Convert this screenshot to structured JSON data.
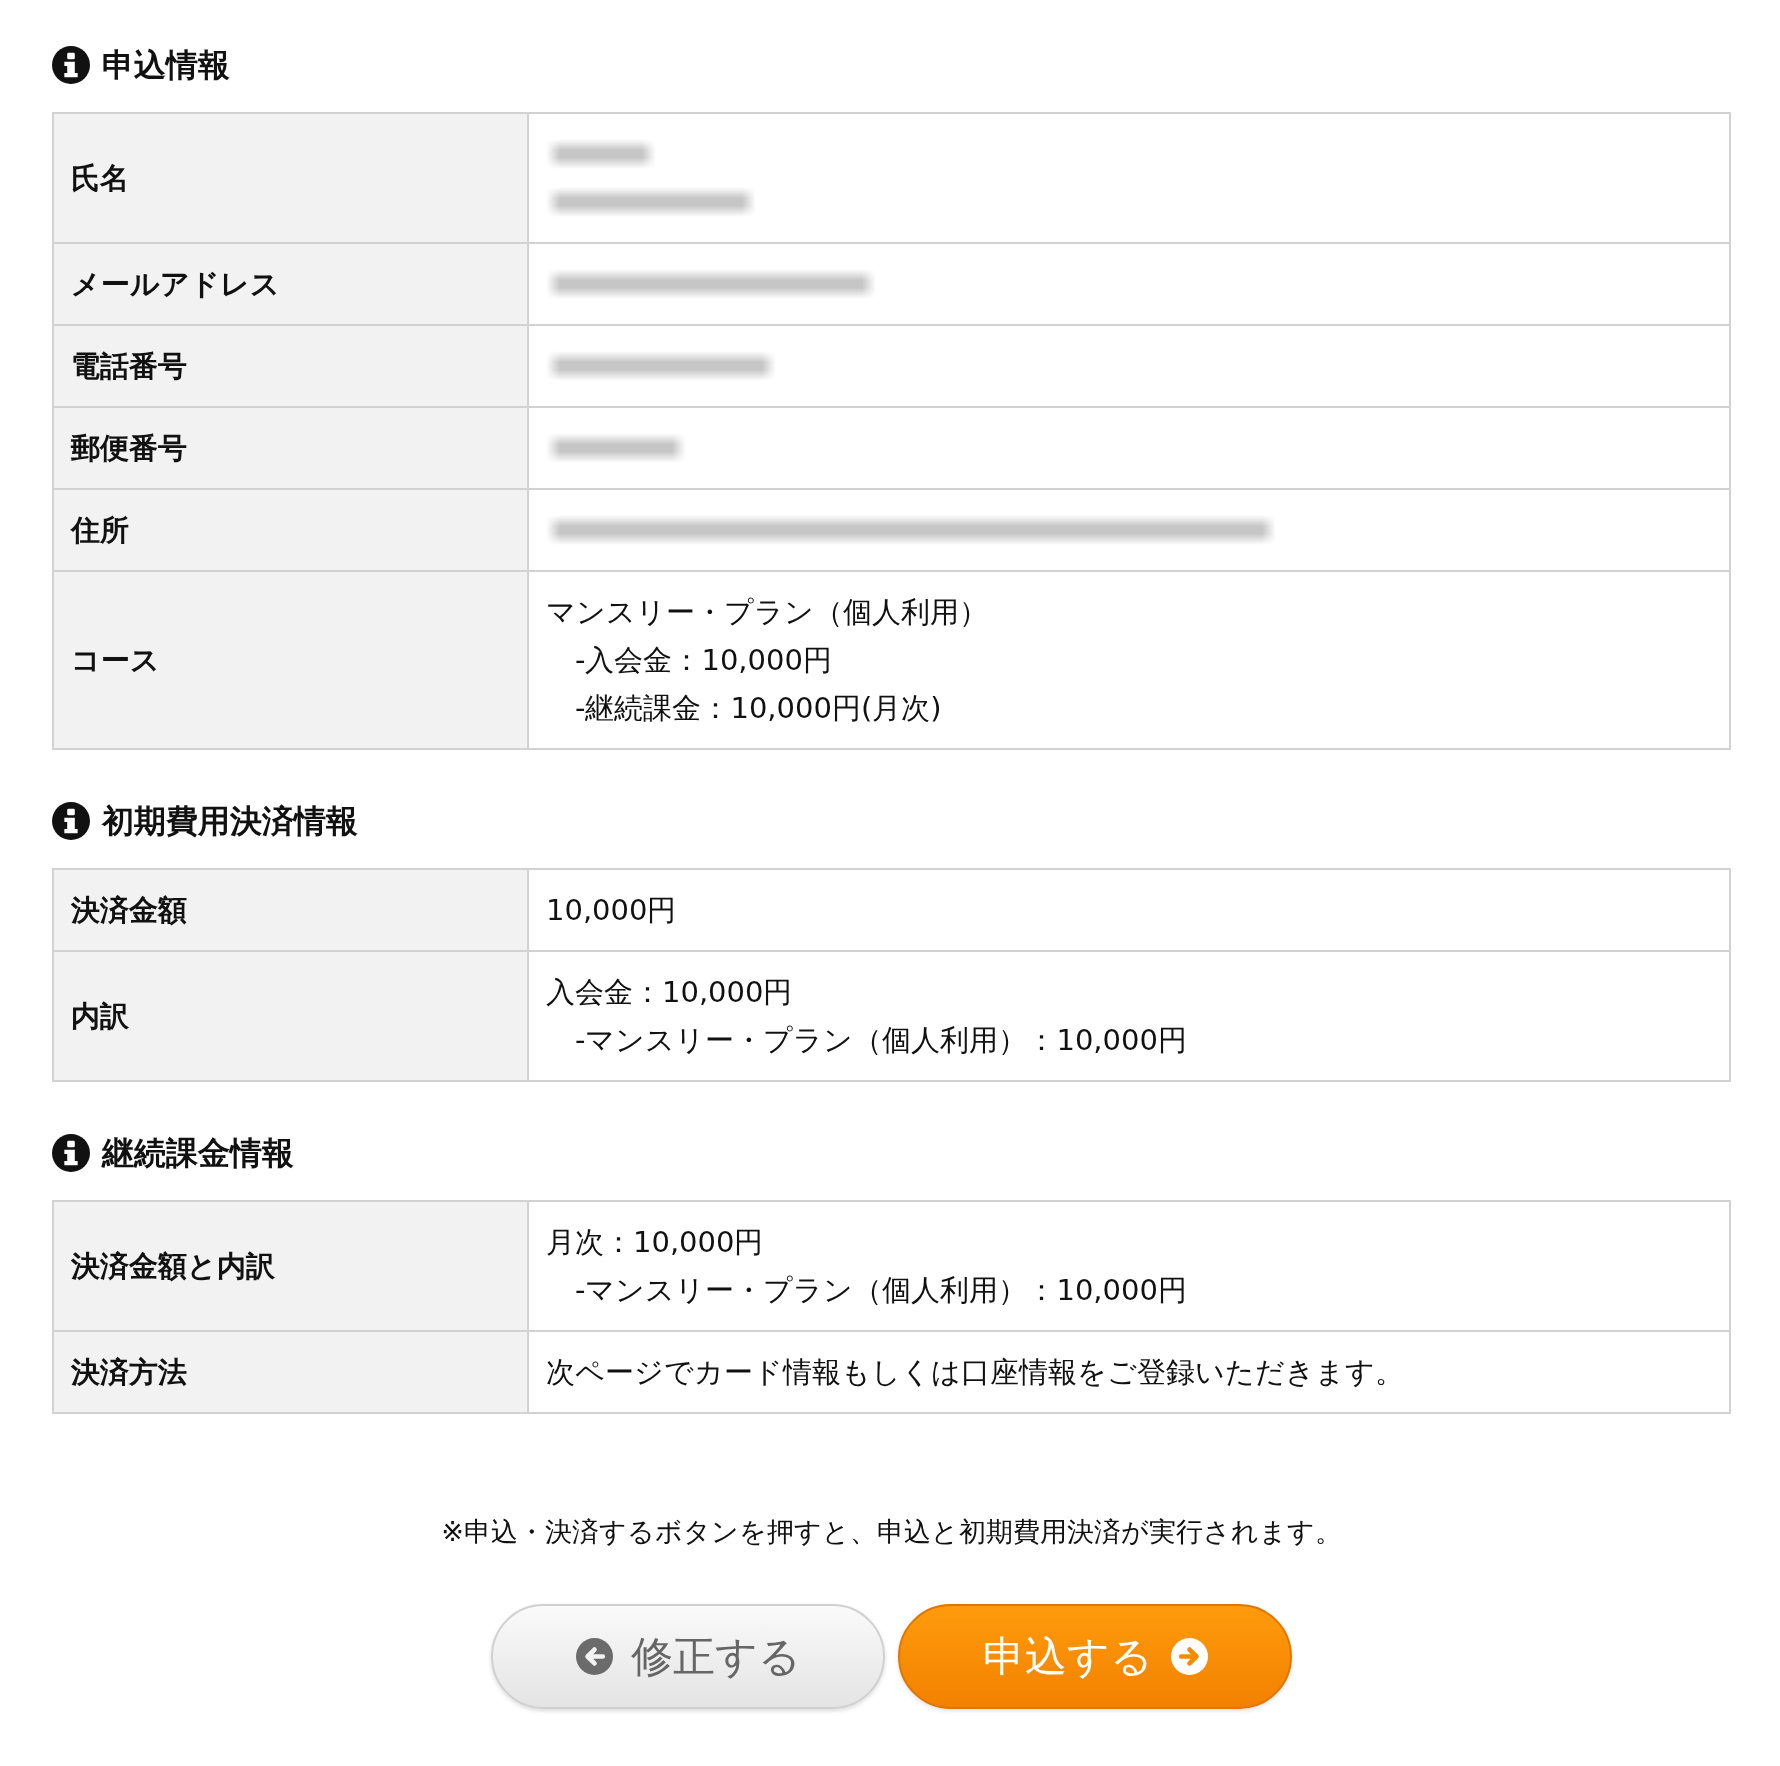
{
  "sections": [
    {
      "title": "申込情報",
      "rows": [
        {
          "label": "氏名",
          "lines": [
            {
              "kind": "blurred"
            },
            {
              "kind": "blurred"
            }
          ]
        },
        {
          "label": "メールアドレス",
          "lines": [
            {
              "kind": "blurred"
            }
          ]
        },
        {
          "label": "電話番号",
          "lines": [
            {
              "kind": "blurred"
            }
          ]
        },
        {
          "label": "郵便番号",
          "lines": [
            {
              "kind": "blurred"
            }
          ]
        },
        {
          "label": "住所",
          "lines": [
            {
              "kind": "blurred"
            }
          ]
        },
        {
          "label": "コース",
          "lines": [
            {
              "kind": "text",
              "text": "マンスリー・プラン（個人利用）",
              "indented": false
            },
            {
              "kind": "text",
              "text": "-入会金：10,000円",
              "indented": true
            },
            {
              "kind": "text",
              "text": "-継続課金：10,000円(月次)",
              "indented": true
            }
          ]
        }
      ]
    },
    {
      "title": "初期費用決済情報",
      "rows": [
        {
          "label": "決済金額",
          "lines": [
            {
              "kind": "text",
              "text": "10,000円",
              "indented": false
            }
          ]
        },
        {
          "label": "内訳",
          "lines": [
            {
              "kind": "text",
              "text": "入会金：10,000円",
              "indented": false
            },
            {
              "kind": "text",
              "text": "-マンスリー・プラン（個人利用）：10,000円",
              "indented": true
            }
          ]
        }
      ]
    },
    {
      "title": "継続課金情報",
      "rows": [
        {
          "label": "決済金額と内訳",
          "lines": [
            {
              "kind": "text",
              "text": "月次：10,000円",
              "indented": false
            },
            {
              "kind": "text",
              "text": "-マンスリー・プラン（個人利用）：10,000円",
              "indented": true
            }
          ]
        },
        {
          "label": "決済方法",
          "lines": [
            {
              "kind": "text",
              "text": "次ページでカード情報もしくは口座情報をご登録いただきます。",
              "indented": false
            }
          ]
        }
      ]
    }
  ],
  "note": "※申込・決済するボタンを押すと、申込と初期費用決済が実行されます。",
  "buttons": [
    {
      "label": "修正する",
      "kind": "back"
    },
    {
      "label": "申込する",
      "kind": "submit"
    }
  ]
}
